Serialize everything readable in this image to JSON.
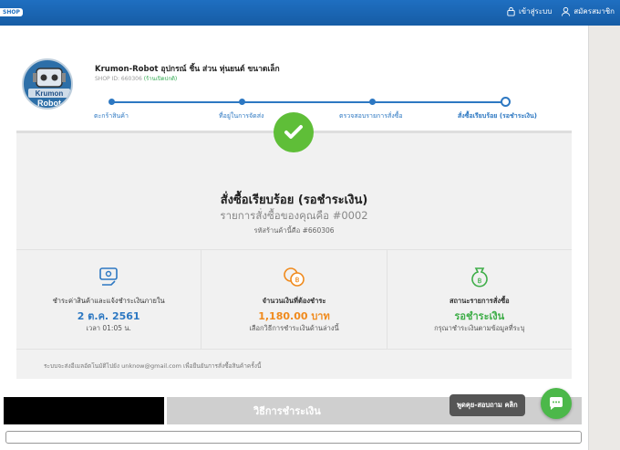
{
  "topbar": {
    "shop_tag": "SHOP",
    "login_label": "เข้าสู่ระบบ",
    "register_label": "สมัครสมาชิก"
  },
  "shop": {
    "name": "Krumon-Robot อุปกรณ์ ชิ้น ส่วน หุ่นยนต์ ขนาดเล็ก",
    "id_text": "SHOP ID: 660306",
    "status": "(ร้านเปิดปกติ)",
    "logo_text_1": "Krumon",
    "logo_text_2": "Robot"
  },
  "steps": [
    {
      "label": "ตะกร้าสินค้า"
    },
    {
      "label": "ที่อยู่ในการจัดส่ง"
    },
    {
      "label": "ตรวจสอบรายการสั่งซื้อ"
    },
    {
      "label": "สั่งซื้อเรียบร้อย (รอชำระเงิน)"
    }
  ],
  "order": {
    "title": "สั่งซื้อเรียบร้อย (รอชำระเงิน)",
    "order_no": "รายการสั่งซื้อของคุณคือ #0002",
    "shop_code": "รหัสร้านค้านี้คือ #660306"
  },
  "columns": {
    "payment_label": "ชำระค่าสินค้าและแจ้งชำระเงินภายใน",
    "payment_date": "2 ต.ค. 2561",
    "payment_time": "เวลา 01:05 น.",
    "amount_label": "จำนวนเงินที่ต้องชำระ",
    "amount_value": "1,180.00 บาท",
    "amount_sub": "เลือกวิธีการชำระเงินด้านล่างนี้",
    "status_label": "สถานะรายการสั่งซื้อ",
    "status_value": "รอชำระเงิน",
    "status_sub": "กรุณาชำระเงินตามข้อมูลที่ระบุ"
  },
  "note": "ระบบจะส่งอีเมลอัตโนมัติไปยัง unknow@gmail.com เพื่อยืนยันการสั่งซื้อสินค้าครั้งนี้",
  "payment_tab": "วิธีการชำระเงิน",
  "chat": {
    "label": "พูดคุย-สอบถาม คลิก"
  },
  "colors": {
    "accent": "#2d78c2",
    "success": "#5fbe38",
    "amount": "#f08a1c",
    "status": "#3fae49"
  }
}
